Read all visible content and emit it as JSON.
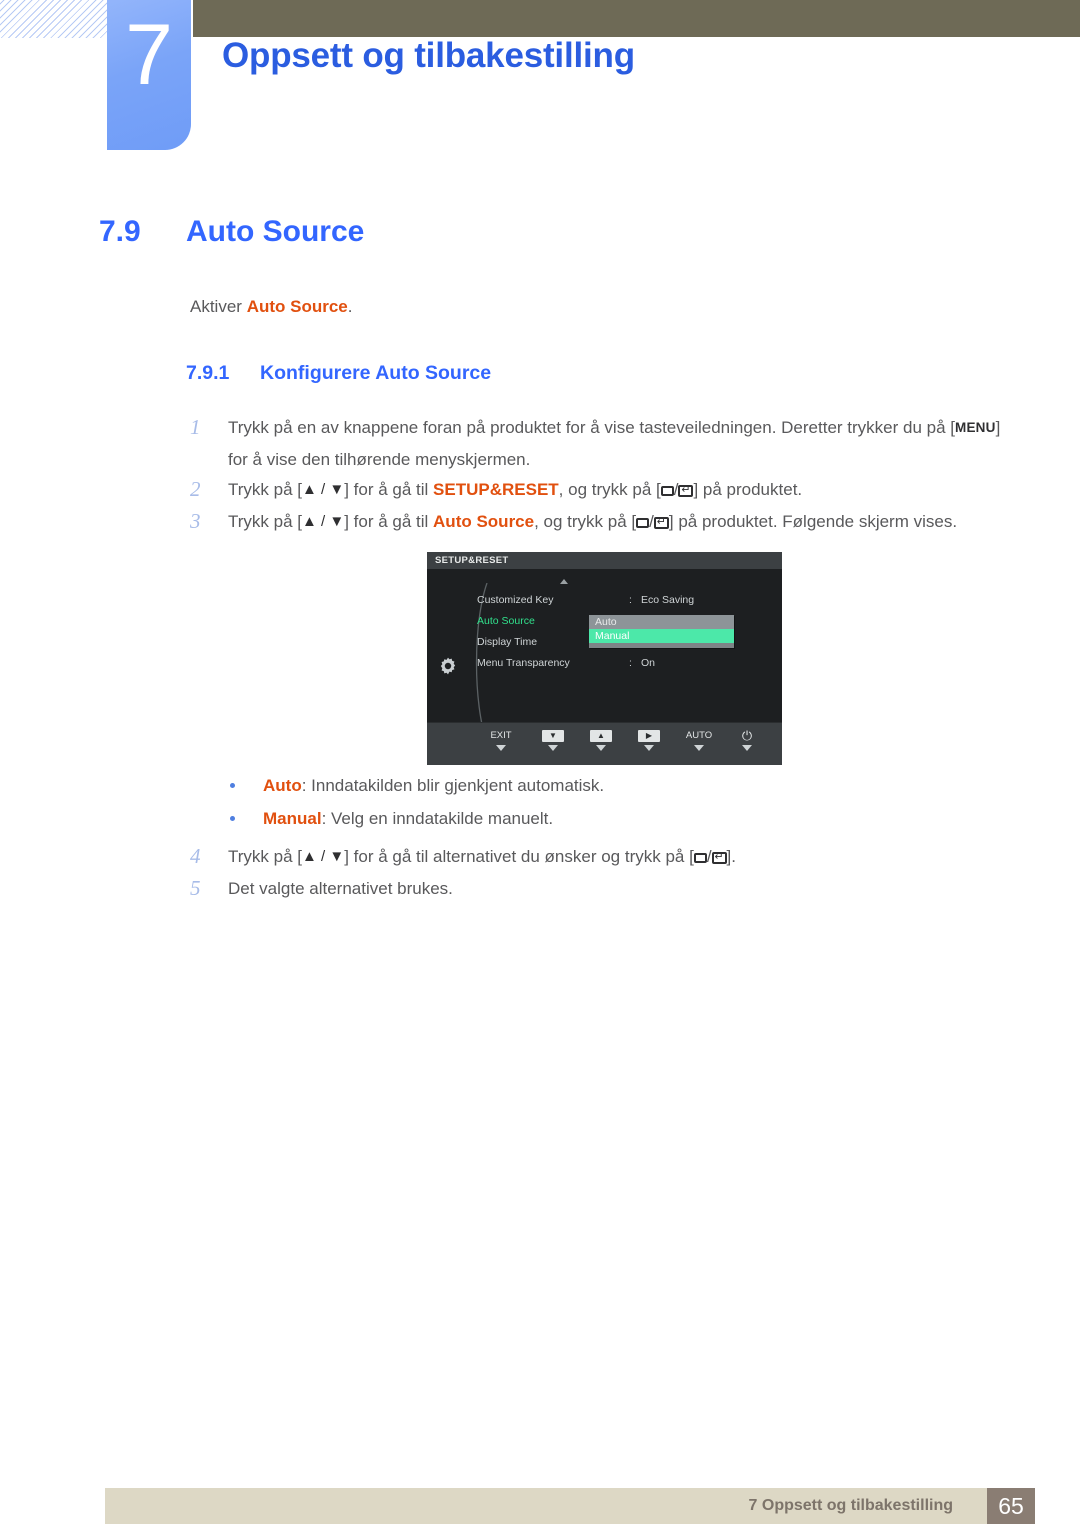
{
  "chapter": {
    "number": "7",
    "title": "Oppsett og tilbakestilling"
  },
  "section": {
    "number": "7.9",
    "title": "Auto Source",
    "lead_prefix": "Aktiver ",
    "lead_highlight": "Auto Source",
    "lead_suffix": "."
  },
  "subsection": {
    "number": "7.9.1",
    "title": "Konfigurere Auto Source"
  },
  "steps": [
    {
      "n": "1",
      "part1": "Trykk på en av knappene foran på produktet for å vise tasteveiledningen. Deretter trykker du på [",
      "key": "MENU",
      "part2": "] for å vise den tilhørende menyskjermen."
    },
    {
      "n": "2",
      "part1": "Trykk på [",
      "arrows": "▲ / ▼",
      "part2": "] for å gå til ",
      "highlight": "SETUP&RESET",
      "part3": ", og trykk på [",
      "part4": "] på produktet."
    },
    {
      "n": "3",
      "part1": "Trykk på [",
      "arrows": "▲ / ▼",
      "part2": "] for å gå til ",
      "highlight": "Auto Source",
      "part3": ", og trykk på [",
      "part4": "] på produktet. Følgende skjerm vises."
    },
    {
      "n": "4",
      "part1": "Trykk på [",
      "arrows": "▲ / ▼",
      "part2": "] for å gå til alternativet du ønsker og trykk på [",
      "part4": "]."
    },
    {
      "n": "5",
      "part1": "Det valgte alternativet brukes."
    }
  ],
  "bullets": [
    {
      "term": "Auto",
      "desc": ": Inndatakilden blir gjenkjent automatisk."
    },
    {
      "term": "Manual",
      "desc": ": Velg en inndatakilde manuelt."
    }
  ],
  "osd": {
    "title": "SETUP&RESET",
    "rows": [
      {
        "label": "Customized Key",
        "colon": ":",
        "value": "Eco Saving"
      },
      {
        "label": "Auto Source",
        "colon": ":",
        "value": ""
      },
      {
        "label": "Display Time",
        "colon": ":",
        "value": ""
      },
      {
        "label": "Menu Transparency",
        "colon": ":",
        "value": "On"
      }
    ],
    "dropdown": [
      {
        "label": "Auto",
        "state": "plain"
      },
      {
        "label": "Manual",
        "state": "active"
      }
    ],
    "buttons": [
      {
        "label": "EXIT",
        "type": "text"
      },
      {
        "label": "▼",
        "type": "box"
      },
      {
        "label": "▲",
        "type": "box"
      },
      {
        "label": "▶",
        "type": "box"
      },
      {
        "label": "AUTO",
        "type": "text"
      },
      {
        "label": "⏻",
        "type": "power"
      }
    ]
  },
  "footer": {
    "text": "7 Oppsett og tilbakestilling",
    "page": "65"
  }
}
